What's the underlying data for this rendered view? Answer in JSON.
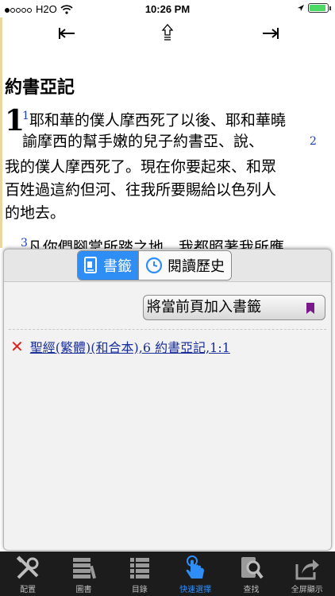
{
  "status_bar": {
    "carrier": "H2O",
    "time": "10:26 PM"
  },
  "nav": {
    "prev_icon": "first-arrow",
    "up_icon": "up-arrow",
    "next_icon": "last-arrow"
  },
  "reader": {
    "book_title": "約書亞記",
    "chapter_number": "1",
    "verse1_num": "1",
    "line1": "耶和華的僕人摩西死了以後、耶和華曉",
    "line2": "諭摩西的幫手嫩的兒子約書亞、說、",
    "verse2_num": "2",
    "line3": "我的僕人摩西死了。現在你要起來、和眾",
    "line4": "百姓過這約但河、往我所要賜給以色列人",
    "line5": "的地去。",
    "verse3_num": "3",
    "line6": "凡你們腳掌所踏之地、我都照著我所應"
  },
  "panel": {
    "tabs": [
      {
        "label": "書籤",
        "icon": "bookmark-doc-icon",
        "active": true
      },
      {
        "label": "閱讀歷史",
        "icon": "clock-icon",
        "active": false
      }
    ],
    "add_button_label": "將當前頁加入書籤",
    "bookmarks": [
      {
        "label": "聖經(繁體)(和合本),6 約書亞記,1:1"
      }
    ]
  },
  "toolbar": {
    "items": [
      {
        "label": "配置",
        "icon": "tools-icon"
      },
      {
        "label": "圖書",
        "icon": "books-icon"
      },
      {
        "label": "目錄",
        "icon": "list-icon"
      },
      {
        "label": "快速選擇",
        "icon": "hand-tap-icon",
        "active": true
      },
      {
        "label": "查找",
        "icon": "search-doc-icon"
      },
      {
        "label": "全屏顯示",
        "icon": "share-fullscreen-icon"
      }
    ]
  },
  "colors": {
    "accent": "#2f8ef5",
    "verse_number": "#1a3fbf",
    "delete": "#e02020",
    "bookmark_flag": "#7a1a8a",
    "toolbar_bg": "#1c1c1c"
  }
}
